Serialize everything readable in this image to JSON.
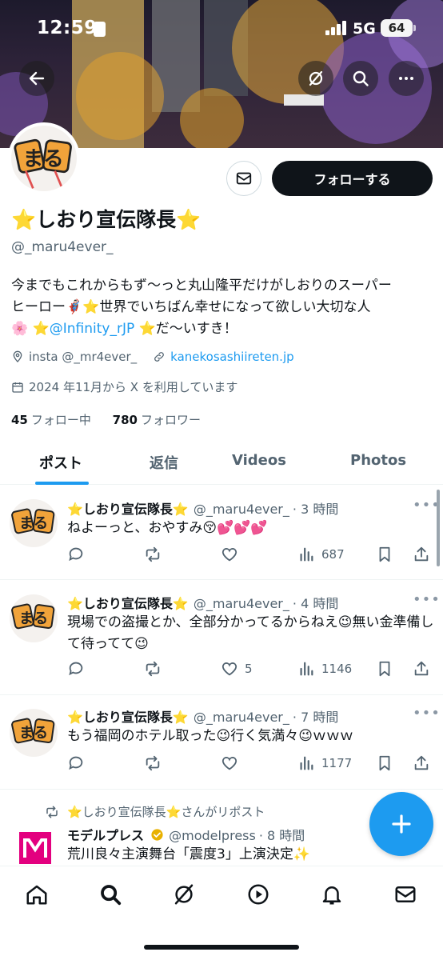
{
  "status_bar": {
    "time": "12:59",
    "network": "5G",
    "battery": "64"
  },
  "profile": {
    "display_name": "⭐️しおり宣伝隊長⭐️",
    "handle": "@_maru4ever_",
    "follow_label": "フォローする",
    "bio_line1": "今までもこれからもず〜っと丸山隆平だけがしおりのスーパー",
    "bio_line2": "ヒーロー🦸🏻‍♂️⭐️世界でいちばん幸せになって欲しい大切な人",
    "bio_line3_pre": "🌸 ⭐️",
    "bio_mention": "@Infinity_rJP",
    "bio_line3_post": " ⭐️だ〜いすき！",
    "location": "insta @_mr4ever_",
    "website": "kanekosashiireten.jp",
    "joined": "2024 年11月から X を利用しています",
    "following_count": "45",
    "following_label": "フォロー中",
    "followers_count": "780",
    "followers_label": "フォロワー",
    "avatar_text": "まる"
  },
  "tabs": [
    "ポスト",
    "返信",
    "Videos",
    "Photos"
  ],
  "posts": [
    {
      "name": "⭐️しおり宣伝隊長⭐️",
      "handle": "@_maru4ever_",
      "time": "· 3 時間",
      "text": "ねよーっと、おやすみ😚💕💕💕",
      "likes": "",
      "views": "687"
    },
    {
      "name": "⭐️しおり宣伝隊長⭐️",
      "handle": "@_maru4ever_",
      "time": "· 4 時間",
      "text": "現場での盗撮とか、全部分かってるからねえ😉無い金準備して待ってて😉",
      "likes": "5",
      "views": "1146"
    },
    {
      "name": "⭐️しおり宣伝隊長⭐️",
      "handle": "@_maru4ever_",
      "time": "· 7 時間",
      "text": "もう福岡のホテル取った😉行く気満々😉ｗｗｗ",
      "likes": "",
      "views": "1177"
    }
  ],
  "repost": {
    "label": "⭐️しおり宣伝隊長⭐️さんがリポスト",
    "name": "モデルプレス",
    "handle": "@modelpress",
    "time": "· 8 時間",
    "text": "荒川良々主演舞台「震度3」上演決定✨"
  },
  "colors": {
    "accent": "#1d9bf0",
    "text": "#0f1419",
    "muted": "#536471"
  }
}
